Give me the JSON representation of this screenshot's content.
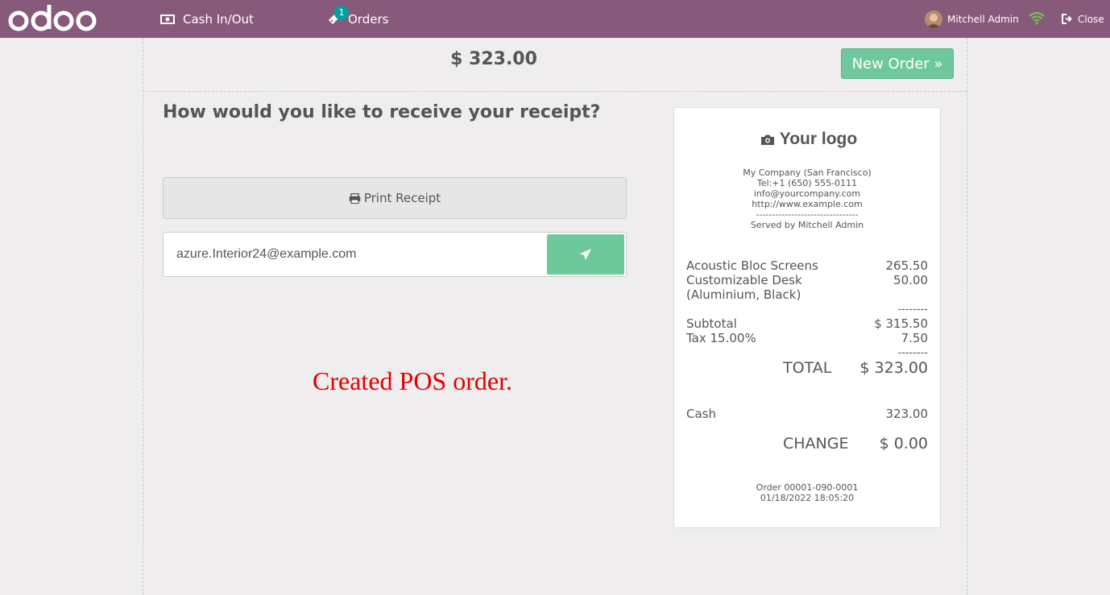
{
  "header": {
    "logo_text": "odoo",
    "cash_in_out_label": "Cash In/Out",
    "orders_label": "Orders",
    "orders_badge": "1",
    "user_name": "Mitchell Admin",
    "close_label": "Close",
    "bar_color": "#875a7b"
  },
  "payment": {
    "total": "$ 323.00",
    "new_order_label": "New Order »",
    "question": "How would you like to receive your receipt?",
    "print_label": "Print Receipt",
    "email_value": "azure.Interior24@example.com",
    "status_message": "Created POS order."
  },
  "receipt": {
    "logo_text": "Your logo",
    "company": "My Company (San Francisco)",
    "tel": "Tel:+1 (650) 555-0111",
    "email": "info@yourcompany.com",
    "website": "http://www.example.com",
    "separator": "--------------------------------",
    "served_by": "Served by Mitchell Admin",
    "lines": [
      {
        "name": "Acoustic Bloc Screens",
        "price": "265.50"
      },
      {
        "name": "Customizable Desk",
        "price": "50.00"
      },
      {
        "name": "(Aluminium, Black)",
        "price": ""
      }
    ],
    "dashes": "--------",
    "subtotal_label": "Subtotal",
    "subtotal_value": "$ 315.50",
    "tax_label": "Tax 15.00%",
    "tax_value": "7.50",
    "total_label": "TOTAL",
    "total_value": "$ 323.00",
    "cash_label": "Cash",
    "cash_value": "323.00",
    "change_label": "CHANGE",
    "change_value": "$ 0.00",
    "order_ref": "Order 00001-090-0001",
    "order_date": "01/18/2022 18:05:20"
  },
  "colors": {
    "accent_green": "#6ec89b",
    "status_red": "#e00000",
    "badge_teal": "#00a09d"
  }
}
